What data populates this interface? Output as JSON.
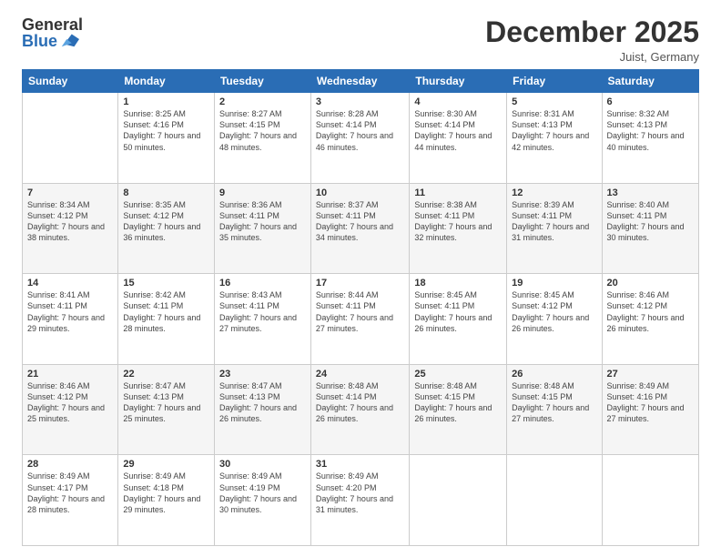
{
  "logo": {
    "general": "General",
    "blue": "Blue"
  },
  "title": "December 2025",
  "location": "Juist, Germany",
  "days_header": [
    "Sunday",
    "Monday",
    "Tuesday",
    "Wednesday",
    "Thursday",
    "Friday",
    "Saturday"
  ],
  "weeks": [
    [
      {
        "day": "",
        "sunrise": "",
        "sunset": "",
        "daylight": ""
      },
      {
        "day": "1",
        "sunrise": "Sunrise: 8:25 AM",
        "sunset": "Sunset: 4:16 PM",
        "daylight": "Daylight: 7 hours and 50 minutes."
      },
      {
        "day": "2",
        "sunrise": "Sunrise: 8:27 AM",
        "sunset": "Sunset: 4:15 PM",
        "daylight": "Daylight: 7 hours and 48 minutes."
      },
      {
        "day": "3",
        "sunrise": "Sunrise: 8:28 AM",
        "sunset": "Sunset: 4:14 PM",
        "daylight": "Daylight: 7 hours and 46 minutes."
      },
      {
        "day": "4",
        "sunrise": "Sunrise: 8:30 AM",
        "sunset": "Sunset: 4:14 PM",
        "daylight": "Daylight: 7 hours and 44 minutes."
      },
      {
        "day": "5",
        "sunrise": "Sunrise: 8:31 AM",
        "sunset": "Sunset: 4:13 PM",
        "daylight": "Daylight: 7 hours and 42 minutes."
      },
      {
        "day": "6",
        "sunrise": "Sunrise: 8:32 AM",
        "sunset": "Sunset: 4:13 PM",
        "daylight": "Daylight: 7 hours and 40 minutes."
      }
    ],
    [
      {
        "day": "7",
        "sunrise": "Sunrise: 8:34 AM",
        "sunset": "Sunset: 4:12 PM",
        "daylight": "Daylight: 7 hours and 38 minutes."
      },
      {
        "day": "8",
        "sunrise": "Sunrise: 8:35 AM",
        "sunset": "Sunset: 4:12 PM",
        "daylight": "Daylight: 7 hours and 36 minutes."
      },
      {
        "day": "9",
        "sunrise": "Sunrise: 8:36 AM",
        "sunset": "Sunset: 4:11 PM",
        "daylight": "Daylight: 7 hours and 35 minutes."
      },
      {
        "day": "10",
        "sunrise": "Sunrise: 8:37 AM",
        "sunset": "Sunset: 4:11 PM",
        "daylight": "Daylight: 7 hours and 34 minutes."
      },
      {
        "day": "11",
        "sunrise": "Sunrise: 8:38 AM",
        "sunset": "Sunset: 4:11 PM",
        "daylight": "Daylight: 7 hours and 32 minutes."
      },
      {
        "day": "12",
        "sunrise": "Sunrise: 8:39 AM",
        "sunset": "Sunset: 4:11 PM",
        "daylight": "Daylight: 7 hours and 31 minutes."
      },
      {
        "day": "13",
        "sunrise": "Sunrise: 8:40 AM",
        "sunset": "Sunset: 4:11 PM",
        "daylight": "Daylight: 7 hours and 30 minutes."
      }
    ],
    [
      {
        "day": "14",
        "sunrise": "Sunrise: 8:41 AM",
        "sunset": "Sunset: 4:11 PM",
        "daylight": "Daylight: 7 hours and 29 minutes."
      },
      {
        "day": "15",
        "sunrise": "Sunrise: 8:42 AM",
        "sunset": "Sunset: 4:11 PM",
        "daylight": "Daylight: 7 hours and 28 minutes."
      },
      {
        "day": "16",
        "sunrise": "Sunrise: 8:43 AM",
        "sunset": "Sunset: 4:11 PM",
        "daylight": "Daylight: 7 hours and 27 minutes."
      },
      {
        "day": "17",
        "sunrise": "Sunrise: 8:44 AM",
        "sunset": "Sunset: 4:11 PM",
        "daylight": "Daylight: 7 hours and 27 minutes."
      },
      {
        "day": "18",
        "sunrise": "Sunrise: 8:45 AM",
        "sunset": "Sunset: 4:11 PM",
        "daylight": "Daylight: 7 hours and 26 minutes."
      },
      {
        "day": "19",
        "sunrise": "Sunrise: 8:45 AM",
        "sunset": "Sunset: 4:12 PM",
        "daylight": "Daylight: 7 hours and 26 minutes."
      },
      {
        "day": "20",
        "sunrise": "Sunrise: 8:46 AM",
        "sunset": "Sunset: 4:12 PM",
        "daylight": "Daylight: 7 hours and 26 minutes."
      }
    ],
    [
      {
        "day": "21",
        "sunrise": "Sunrise: 8:46 AM",
        "sunset": "Sunset: 4:12 PM",
        "daylight": "Daylight: 7 hours and 25 minutes."
      },
      {
        "day": "22",
        "sunrise": "Sunrise: 8:47 AM",
        "sunset": "Sunset: 4:13 PM",
        "daylight": "Daylight: 7 hours and 25 minutes."
      },
      {
        "day": "23",
        "sunrise": "Sunrise: 8:47 AM",
        "sunset": "Sunset: 4:13 PM",
        "daylight": "Daylight: 7 hours and 26 minutes."
      },
      {
        "day": "24",
        "sunrise": "Sunrise: 8:48 AM",
        "sunset": "Sunset: 4:14 PM",
        "daylight": "Daylight: 7 hours and 26 minutes."
      },
      {
        "day": "25",
        "sunrise": "Sunrise: 8:48 AM",
        "sunset": "Sunset: 4:15 PM",
        "daylight": "Daylight: 7 hours and 26 minutes."
      },
      {
        "day": "26",
        "sunrise": "Sunrise: 8:48 AM",
        "sunset": "Sunset: 4:15 PM",
        "daylight": "Daylight: 7 hours and 27 minutes."
      },
      {
        "day": "27",
        "sunrise": "Sunrise: 8:49 AM",
        "sunset": "Sunset: 4:16 PM",
        "daylight": "Daylight: 7 hours and 27 minutes."
      }
    ],
    [
      {
        "day": "28",
        "sunrise": "Sunrise: 8:49 AM",
        "sunset": "Sunset: 4:17 PM",
        "daylight": "Daylight: 7 hours and 28 minutes."
      },
      {
        "day": "29",
        "sunrise": "Sunrise: 8:49 AM",
        "sunset": "Sunset: 4:18 PM",
        "daylight": "Daylight: 7 hours and 29 minutes."
      },
      {
        "day": "30",
        "sunrise": "Sunrise: 8:49 AM",
        "sunset": "Sunset: 4:19 PM",
        "daylight": "Daylight: 7 hours and 30 minutes."
      },
      {
        "day": "31",
        "sunrise": "Sunrise: 8:49 AM",
        "sunset": "Sunset: 4:20 PM",
        "daylight": "Daylight: 7 hours and 31 minutes."
      },
      {
        "day": "",
        "sunrise": "",
        "sunset": "",
        "daylight": ""
      },
      {
        "day": "",
        "sunrise": "",
        "sunset": "",
        "daylight": ""
      },
      {
        "day": "",
        "sunrise": "",
        "sunset": "",
        "daylight": ""
      }
    ]
  ]
}
